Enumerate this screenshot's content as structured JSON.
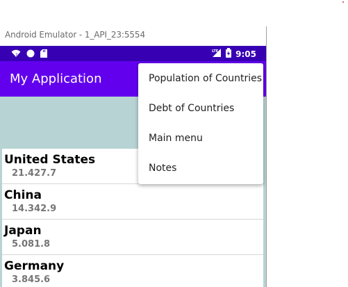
{
  "emulator": {
    "title": "Android Emulator - 1_API_23:5554"
  },
  "statusbar": {
    "icons_left": [
      "wifi-question-icon",
      "circle-icon",
      "sd-card-icon"
    ],
    "network_label": "LTE",
    "time": "9:05"
  },
  "appbar": {
    "title": "My Application"
  },
  "countries": [
    {
      "name": "United States",
      "value": "21.427.7"
    },
    {
      "name": "China",
      "value": "14.342.9"
    },
    {
      "name": "Japan",
      "value": "5.081.8"
    },
    {
      "name": "Germany",
      "value": "3.845.6"
    }
  ],
  "menu": {
    "items": [
      {
        "label": "Population of Countries"
      },
      {
        "label": "Debt of Countries"
      },
      {
        "label": "Main menu"
      },
      {
        "label": "Notes"
      }
    ]
  },
  "colors": {
    "statusbar": "#3700b3",
    "appbar": "#6200ee",
    "content_bg": "#b7d3d3"
  }
}
